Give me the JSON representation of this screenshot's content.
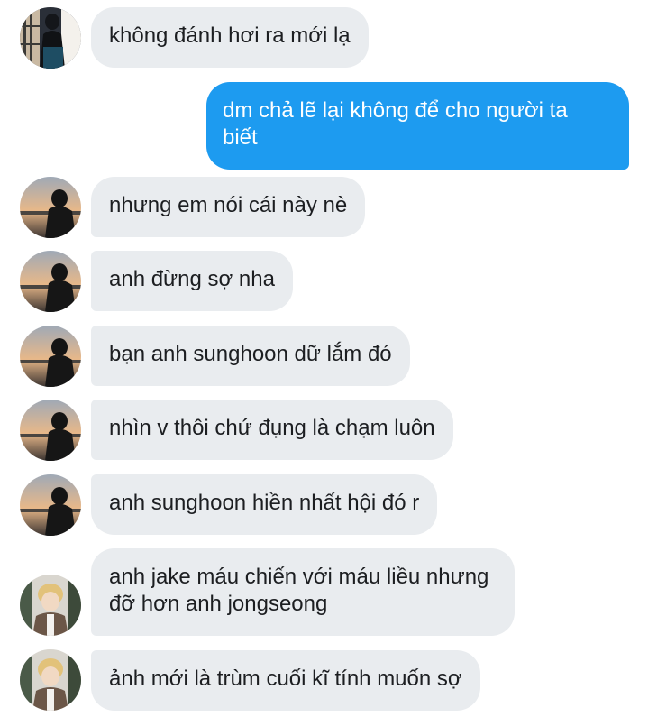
{
  "conversation": {
    "messages": [
      {
        "sender": "contact-1",
        "text": "không đánh hơi ra mới lạ"
      },
      {
        "sender": "me",
        "text": "dm chả lẽ lại không để cho người ta biết"
      },
      {
        "sender": "contact-2",
        "text": "nhưng em nói cái này nè"
      },
      {
        "sender": "contact-2",
        "text": "anh đừng sợ nha"
      },
      {
        "sender": "contact-2",
        "text": "bạn anh sunghoon dữ lắm đó"
      },
      {
        "sender": "contact-2",
        "text": "nhìn v thôi chứ đụng là chạm luôn"
      },
      {
        "sender": "contact-2",
        "text": "anh sunghoon hiền nhất hội đó r"
      },
      {
        "sender": "contact-3",
        "text": "anh jake máu chiến với máu liều nhưng đỡ hơn anh jongseong"
      },
      {
        "sender": "contact-3",
        "text": "ảnh mới là trùm cuối kĩ tính muốn sợ"
      }
    ]
  },
  "colors": {
    "incoming_bubble": "#e9ecef",
    "outgoing_bubble": "#1d9bf0",
    "incoming_text": "#1c1e21",
    "outgoing_text": "#ffffff"
  }
}
